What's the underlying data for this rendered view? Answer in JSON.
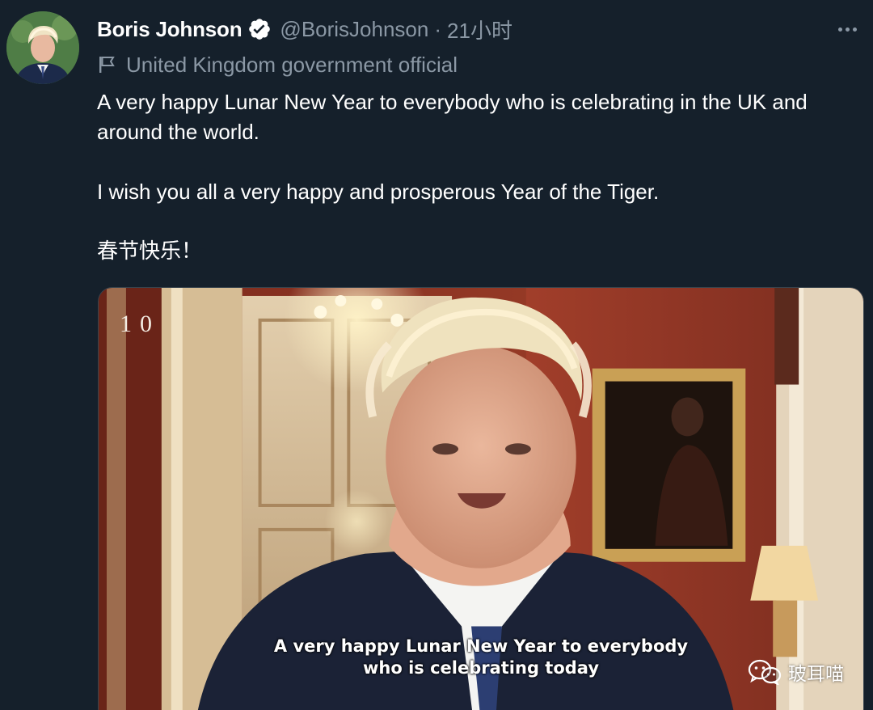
{
  "tweet": {
    "author": {
      "name": "Boris Johnson",
      "handle": "@BorisJohnson",
      "verified": true,
      "label": "United Kingdom government official"
    },
    "separator": "·",
    "timestamp": "21小时",
    "text": {
      "line1": "A very happy Lunar New Year to everybody who is celebrating in the UK and around the world.",
      "line2": "I wish you all a very happy and prosperous Year of the Tiger.",
      "line3": "春节快乐！"
    },
    "media": {
      "corner_mark": "10",
      "caption_line1": "A very happy Lunar New Year to everybody",
      "caption_line2": "who is celebrating today",
      "watermark": "玻耳喵"
    }
  },
  "icons": {
    "verified": "verified-badge-icon",
    "label": "flag-icon",
    "more": "more-options-icon",
    "watermark": "wechat-icon"
  },
  "colors": {
    "background": "#15202b",
    "text_primary": "#ffffff",
    "text_secondary": "#8b98a5",
    "border": "#38444d"
  }
}
